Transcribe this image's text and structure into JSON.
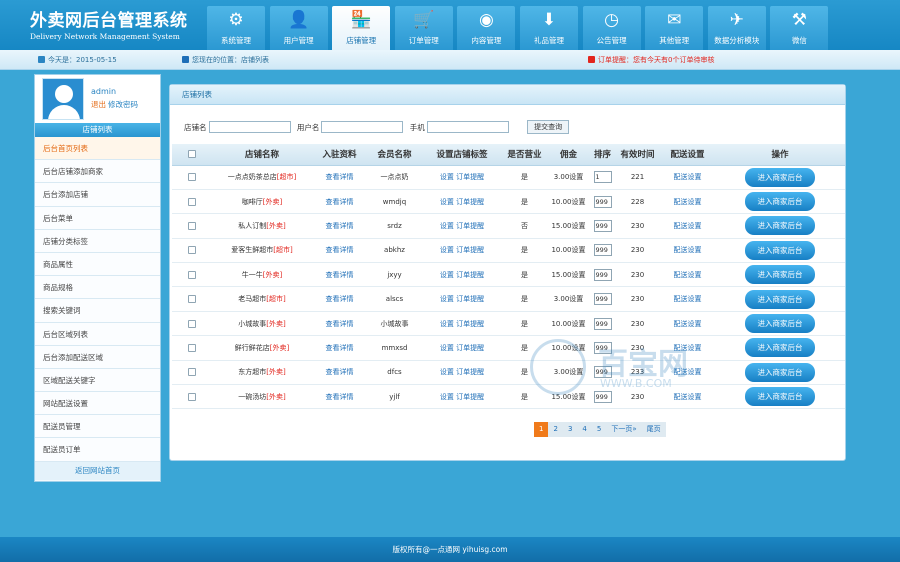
{
  "header": {
    "title_cn": "外卖网后台管理系统",
    "title_en": "Delivery Network Management System",
    "nav": [
      {
        "label": "系统管理",
        "icon": "gear-icon",
        "glyph": "⚙"
      },
      {
        "label": "用户管理",
        "icon": "user-icon",
        "glyph": "👤"
      },
      {
        "label": "店铺管理",
        "icon": "store-icon",
        "glyph": "🏪"
      },
      {
        "label": "订单管理",
        "icon": "cart-icon",
        "glyph": "🛒"
      },
      {
        "label": "内容管理",
        "icon": "film-reel-icon",
        "glyph": "◉"
      },
      {
        "label": "礼品管理",
        "icon": "gift-download-icon",
        "glyph": "⬇"
      },
      {
        "label": "公告管理",
        "icon": "clock-icon",
        "glyph": "◷"
      },
      {
        "label": "其他管理",
        "icon": "envelope-icon",
        "glyph": "✉"
      },
      {
        "label": "数据分析模块",
        "icon": "airplane-icon",
        "glyph": "✈"
      },
      {
        "label": "微信",
        "icon": "hammer-icon",
        "glyph": "⚒"
      }
    ]
  },
  "infobar": {
    "today": "今天是：2015-05-15",
    "location": "您现在的位置：店铺列表",
    "alert": "订单提醒：您有今天有0个订单待审核"
  },
  "sidebar": {
    "username": "admin",
    "logout": "退出",
    "change_password": "修改密码",
    "section_title": "店铺列表",
    "items": [
      "后台首页列表",
      "后台店铺添加商家",
      "后台添加店铺",
      "后台菜单",
      "店铺分类标签",
      "商品属性",
      "商品规格",
      "搜索关键词",
      "后台区域列表",
      "后台添加配送区域",
      "区域配送关键字",
      "网站配送设置",
      "配送员管理",
      "配送员订单"
    ],
    "footer_link": "返回网站首页"
  },
  "main": {
    "title": "店铺列表",
    "search": {
      "shop_name_label": "店铺名",
      "username_label": "用户名",
      "phone_label": "手机",
      "button": "提交查询"
    },
    "columns": [
      "",
      "店铺名称",
      "入驻资料",
      "会员名称",
      "设置店铺标签",
      "是否营业",
      "佣金",
      "排序",
      "有效时间",
      "配送设置",
      "操作"
    ],
    "rows": [
      {
        "name": "一点点奶茶总店",
        "tag": "[超市]",
        "info": "查看详情",
        "member": "一点点奶",
        "labels": "设置  订单提醒",
        "open": "是",
        "commission": "3.00设置",
        "order": "1",
        "valid": "221",
        "delivery": "配送设置",
        "action": "进入商家后台"
      },
      {
        "name": "咖啡厅",
        "tag": "[外卖]",
        "info": "查看详情",
        "member": "wmdjq",
        "labels": "设置  订单提醒",
        "open": "是",
        "commission": "10.00设置",
        "order": "999",
        "valid": "228",
        "delivery": "配送设置",
        "action": "进入商家后台"
      },
      {
        "name": "私人订制",
        "tag": "[外卖]",
        "info": "查看详情",
        "member": "srdz",
        "labels": "设置  订单提醒",
        "open": "否",
        "commission": "15.00设置",
        "order": "999",
        "valid": "230",
        "delivery": "配送设置",
        "action": "进入商家后台"
      },
      {
        "name": "爱客生鲜超市",
        "tag": "[超市]",
        "info": "查看详情",
        "member": "abkhz",
        "labels": "设置  订单提醒",
        "open": "是",
        "commission": "10.00设置",
        "order": "999",
        "valid": "230",
        "delivery": "配送设置",
        "action": "进入商家后台"
      },
      {
        "name": "牛一牛",
        "tag": "[外卖]",
        "info": "查看详情",
        "member": "jxyy",
        "labels": "设置  订单提醒",
        "open": "是",
        "commission": "15.00设置",
        "order": "999",
        "valid": "230",
        "delivery": "配送设置",
        "action": "进入商家后台"
      },
      {
        "name": "老马超市",
        "tag": "[超市]",
        "info": "查看详情",
        "member": "alscs",
        "labels": "设置  订单提醒",
        "open": "是",
        "commission": "3.00设置",
        "order": "999",
        "valid": "230",
        "delivery": "配送设置",
        "action": "进入商家后台"
      },
      {
        "name": "小城故事",
        "tag": "[外卖]",
        "info": "查看详情",
        "member": "小城故事",
        "labels": "设置  订单提醒",
        "open": "是",
        "commission": "10.00设置",
        "order": "999",
        "valid": "230",
        "delivery": "配送设置",
        "action": "进入商家后台"
      },
      {
        "name": "鲜行鲜花店",
        "tag": "[外卖]",
        "info": "查看详情",
        "member": "mmxsd",
        "labels": "设置  订单提醒",
        "open": "是",
        "commission": "10.00设置",
        "order": "999",
        "valid": "230",
        "delivery": "配送设置",
        "action": "进入商家后台"
      },
      {
        "name": "东方超市",
        "tag": "[外卖]",
        "info": "查看详情",
        "member": "dfcs",
        "labels": "设置  订单提醒",
        "open": "是",
        "commission": "3.00设置",
        "order": "999",
        "valid": "233",
        "delivery": "配送设置",
        "action": "进入商家后台"
      },
      {
        "name": "一碗汤坊",
        "tag": "[外卖]",
        "info": "查看详情",
        "member": "yjlf",
        "labels": "设置  订单提醒",
        "open": "是",
        "commission": "15.00设置",
        "order": "999",
        "valid": "230",
        "delivery": "配送设置",
        "action": "进入商家后台"
      }
    ],
    "pagination": [
      "1",
      "2",
      "3",
      "4",
      "5",
      "下一页»",
      "尾页"
    ]
  },
  "footer": {
    "copyright": "版权所有@一点通网 yihuisg.com"
  },
  "watermark": {
    "text": "百宝网",
    "sub": "WWW.B.COM"
  },
  "colors": {
    "header_blue": "#1687c4",
    "accent_orange": "#f07a1a",
    "tag_red": "#e2261e",
    "button_blue": "#177fc4"
  }
}
